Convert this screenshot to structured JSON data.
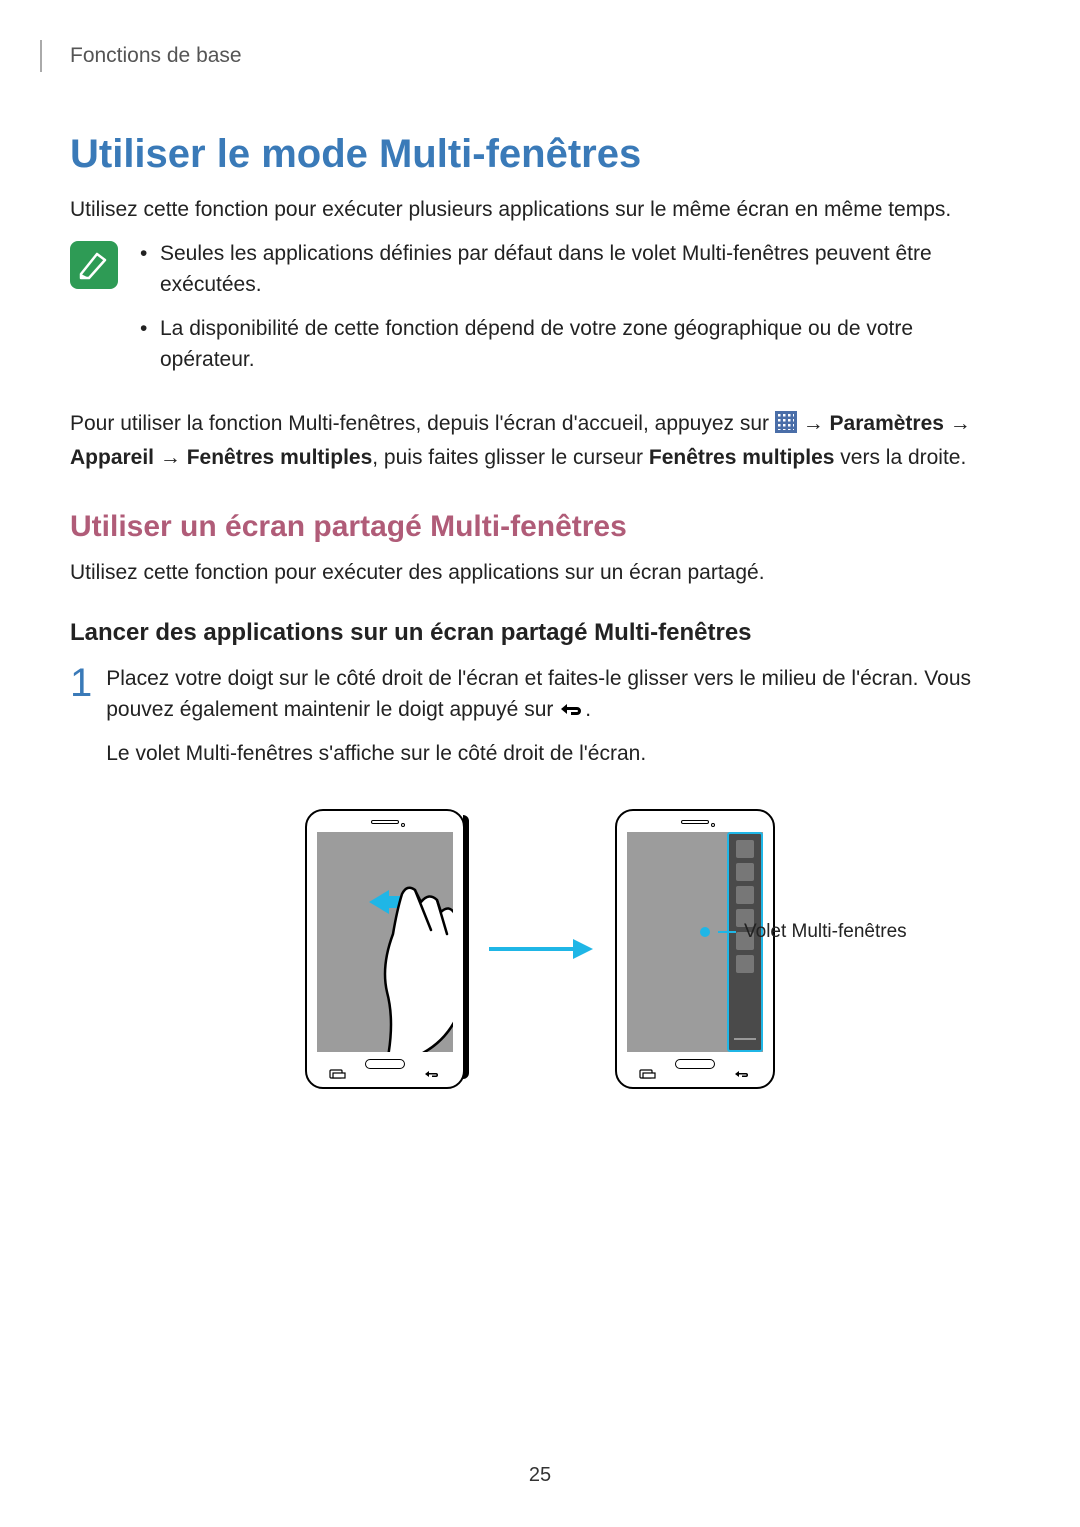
{
  "breadcrumb": "Fonctions de base",
  "h1": "Utiliser le mode Multi-fenêtres",
  "intro": "Utilisez cette fonction pour exécuter plusieurs applications sur le même écran en même temps.",
  "notes": [
    "Seules les applications définies par défaut dans le volet Multi-fenêtres peuvent être exécutées.",
    "La disponibilité de cette fonction dépend de votre zone géographique ou de votre opérateur."
  ],
  "para1_a": "Pour utiliser la fonction Multi-fenêtres, depuis l'écran d'accueil, appuyez sur ",
  "para1_b": " → ",
  "para1_c": "Paramètres",
  "para1_d": " → ",
  "para1_e": "Appareil",
  "para1_f": " → ",
  "para1_g": "Fenêtres multiples",
  "para1_h": ", puis faites glisser le curseur ",
  "para1_i": "Fenêtres multiples",
  "para1_j": " vers la droite.",
  "h2": "Utiliser un écran partagé Multi-fenêtres",
  "h2_desc": "Utilisez cette fonction pour exécuter des applications sur un écran partagé.",
  "h3": "Lancer des applications sur un écran partagé Multi-fenêtres",
  "step1_num": "1",
  "step1_a": "Placez votre doigt sur le côté droit de l'écran et faites-le glisser vers le milieu de l'écran. Vous pouvez également maintenir le doigt appuyé sur ",
  "step1_b": ".",
  "step1_c": "Le volet Multi-fenêtres s'affiche sur le côté droit de l'écran.",
  "callout": "Volet Multi-fenêtres",
  "page_number": "25"
}
